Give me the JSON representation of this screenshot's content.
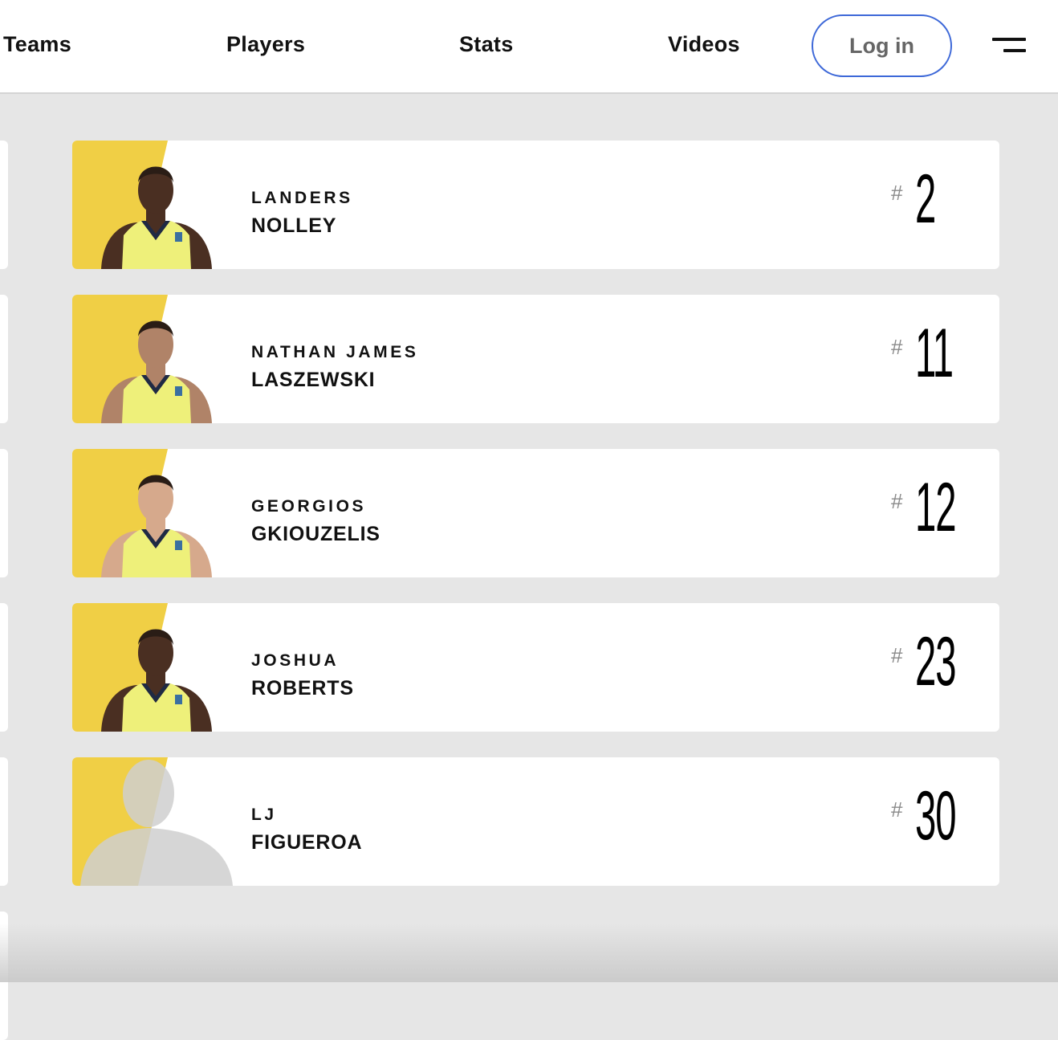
{
  "nav": {
    "items": [
      "Teams",
      "Players",
      "Stats",
      "Videos"
    ],
    "login_label": "Log in",
    "menu_icon": "hamburger-menu-icon",
    "login_border_color": "#3d68d8"
  },
  "roster": {
    "accent_color": "#f0cf45",
    "players": [
      {
        "first_name": "LANDERS",
        "last_name": "NOLLEY",
        "number": "2",
        "hash": "#"
      },
      {
        "first_name": "NATHAN JAMES",
        "last_name": "LASZEWSKI",
        "number": "11",
        "hash": "#"
      },
      {
        "first_name": "GEORGIOS",
        "last_name": "GKIOUZELIS",
        "number": "12",
        "hash": "#"
      },
      {
        "first_name": "JOSHUA",
        "last_name": "ROBERTS",
        "number": "23",
        "hash": "#"
      },
      {
        "first_name": "LJ",
        "last_name": "FIGUEROA",
        "number": "30",
        "hash": "#",
        "placeholder_photo": true
      }
    ]
  }
}
